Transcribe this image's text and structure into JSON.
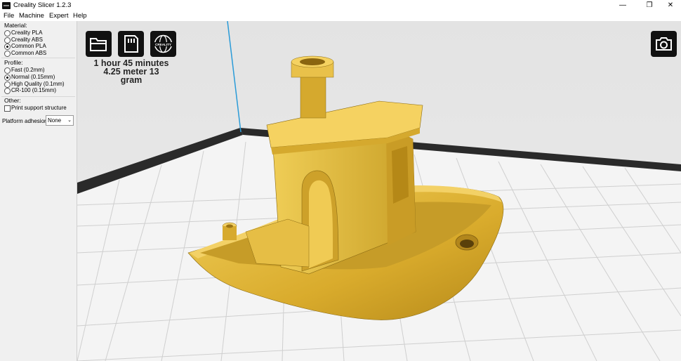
{
  "window": {
    "title": "Creality Slicer 1.2.3",
    "minimize": "—",
    "restore": "❐",
    "close": "✕"
  },
  "menu": [
    "File",
    "Machine",
    "Expert",
    "Help"
  ],
  "material": {
    "title": "Material:",
    "options": [
      "Creality PLA",
      "Creality ABS",
      "Common PLA",
      "Common ABS"
    ],
    "selected": "Common PLA"
  },
  "profile": {
    "title": "Profile:",
    "options": [
      "Fast (0.2mm)",
      "Normal (0.15mm)",
      "High Quality (0.1mm)",
      "CR-100 (0.15mm)"
    ],
    "selected": "Normal (0.15mm)"
  },
  "other": {
    "title": "Other:",
    "support_label": "Print support structure",
    "support_checked": false,
    "adhesion_label": "Platform adhesion",
    "adhesion_value": "None"
  },
  "viewport": {
    "print_time": "1 hour 45 minutes",
    "print_material": "4.25 meter 13 gram",
    "logo_text": "CREALITY",
    "model_color": "#e0b83a"
  },
  "icons": [
    "open-folder-icon",
    "sd-card-icon",
    "creality-web-icon",
    "camera-icon"
  ]
}
